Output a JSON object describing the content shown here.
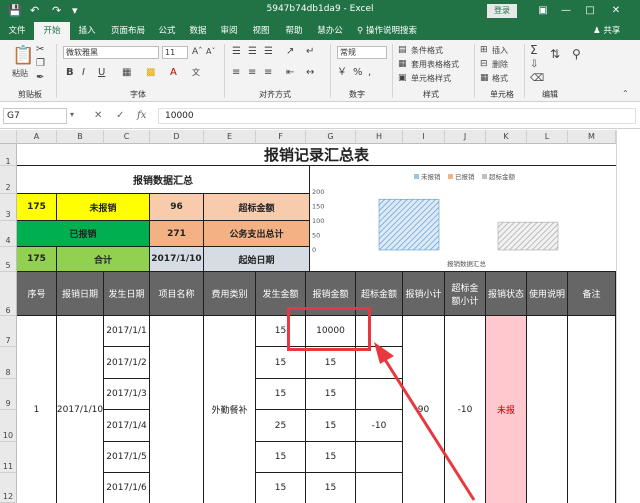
{
  "window": {
    "title": "5947b74db1da9 - Excel",
    "login": "登录",
    "share": "共享"
  },
  "menu": {
    "tabs": [
      "文件",
      "开始",
      "插入",
      "页面布局",
      "公式",
      "数据",
      "审阅",
      "视图",
      "帮助",
      "慧办公"
    ],
    "search": "操作说明搜索"
  },
  "ribbon": {
    "font_name": "微软雅黑",
    "font_size": "11",
    "number_format": "常规",
    "paste": "粘贴",
    "cond_format": "条件格式",
    "table_format": "套用表格格式",
    "cell_style": "单元格样式",
    "insert": "插入",
    "delete": "删除",
    "format": "格式",
    "groups": {
      "clipboard": "剪贴板",
      "font": "字体",
      "align": "对齐方式",
      "number": "数字",
      "style": "样式",
      "cells": "单元格",
      "edit": "编辑"
    }
  },
  "formula_bar": {
    "name_box": "G7",
    "value": "10000"
  },
  "columns": [
    "A",
    "B",
    "C",
    "D",
    "E",
    "F",
    "G",
    "H",
    "I",
    "J",
    "K",
    "L",
    "M"
  ],
  "rows": [
    "1",
    "2",
    "3",
    "4",
    "5",
    "6",
    "7",
    "8",
    "9",
    "10",
    "11",
    "12"
  ],
  "sheet": {
    "title": "报销记录汇总表",
    "summary": {
      "title": "报销数据汇总",
      "unreimbursed_count": "175",
      "unreimbursed_label": "未报销",
      "over_value": "96",
      "over_label": "超标金额",
      "reimbursed_label": "已报销",
      "public_value": "271",
      "public_label": "公务支出总计",
      "total_value": "175",
      "total_label": "合计",
      "start_date": "2017/1/10",
      "start_label": "起始日期"
    },
    "chart_data": {
      "type": "bar",
      "legend": [
        "未报销",
        "已报销",
        "超标金额"
      ],
      "legend_colors": [
        "#9dc3e6",
        "#f4b183",
        "#bfbfbf"
      ],
      "y_ticks": [
        "200",
        "150",
        "100",
        "50",
        "0"
      ],
      "ylim": [
        0,
        200
      ],
      "categories": [
        "报销数据汇总"
      ],
      "series": [
        {
          "name": "未报销",
          "values": [
            175
          ]
        },
        {
          "name": "超标金额",
          "values": [
            96
          ]
        }
      ]
    },
    "headers": [
      "序号",
      "报销日期",
      "发生日期",
      "项目名称",
      "费用类别",
      "发生金额",
      "报销金额",
      "超标金额",
      "报销小计",
      "超标金额小计",
      "报销状态",
      "使用说明",
      "备注"
    ],
    "group": {
      "seq": "1",
      "reimb_date": "2017/1/10",
      "category": "外勤餐补",
      "subtotal": "90",
      "over_subtotal": "-10",
      "status": "未报"
    },
    "detail_rows": [
      {
        "date": "2017/1/1",
        "amount": "15",
        "reimb": "10000",
        "over": ""
      },
      {
        "date": "2017/1/2",
        "amount": "15",
        "reimb": "15",
        "over": ""
      },
      {
        "date": "2017/1/3",
        "amount": "15",
        "reimb": "15",
        "over": ""
      },
      {
        "date": "2017/1/4",
        "amount": "25",
        "reimb": "15",
        "over": "-10"
      },
      {
        "date": "2017/1/5",
        "amount": "15",
        "reimb": "15",
        "over": ""
      },
      {
        "date": "2017/1/6",
        "amount": "15",
        "reimb": "15",
        "over": ""
      }
    ]
  }
}
